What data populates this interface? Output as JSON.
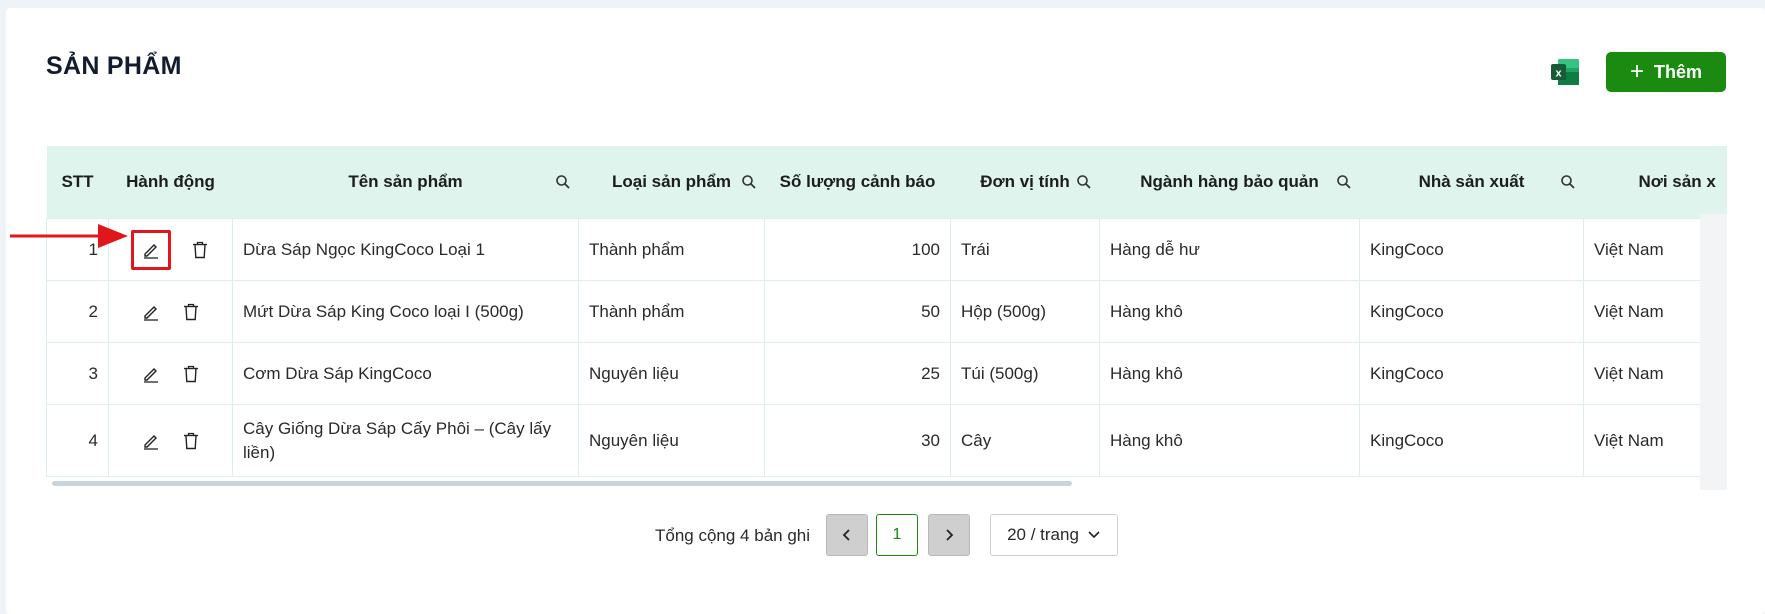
{
  "page": {
    "title": "SẢN PHẨM"
  },
  "toolbar": {
    "excel_icon": "excel-icon",
    "add_label": "Thêm",
    "add_color": "#1a8b10"
  },
  "table": {
    "columns": [
      "STT",
      "Hành động",
      "Tên sản phẩm",
      "Loại sản phẩm",
      "Số lượng cảnh báo",
      "Đơn vị tính",
      "Ngành hàng bảo quản",
      "Nhà sản xuất",
      "Nơi sản x"
    ],
    "rows": [
      {
        "stt": "1",
        "name": "Dừa Sáp Ngọc KingCoco Loại 1",
        "type": "Thành phẩm",
        "qty": "100",
        "unit": "Trái",
        "category": "Hàng dễ hư",
        "maker": "KingCoco",
        "origin": "Việt Nam"
      },
      {
        "stt": "2",
        "name": "Mứt Dừa Sáp King Coco loại I (500g)",
        "type": "Thành phẩm",
        "qty": "50",
        "unit": "Hộp (500g)",
        "category": "Hàng khô",
        "maker": "KingCoco",
        "origin": "Việt Nam"
      },
      {
        "stt": "3",
        "name": "Cơm Dừa Sáp KingCoco",
        "type": "Nguyên liệu",
        "qty": "25",
        "unit": "Túi (500g)",
        "category": "Hàng khô",
        "maker": "KingCoco",
        "origin": "Việt Nam"
      },
      {
        "stt": "4",
        "name": "Cây Giống Dừa Sáp Cấy Phôi – (Cây lấy liền)",
        "type": "Nguyên liệu",
        "qty": "30",
        "unit": "Cây",
        "category": "Hàng khô",
        "maker": "KingCoco",
        "origin": "Việt Nam"
      }
    ],
    "header_bg": "#def4ec",
    "highlight_color": "#e0161b"
  },
  "pagination": {
    "total_text": "Tổng cộng 4 bản ghi",
    "current_page": "1",
    "page_size": "20 / trang"
  }
}
